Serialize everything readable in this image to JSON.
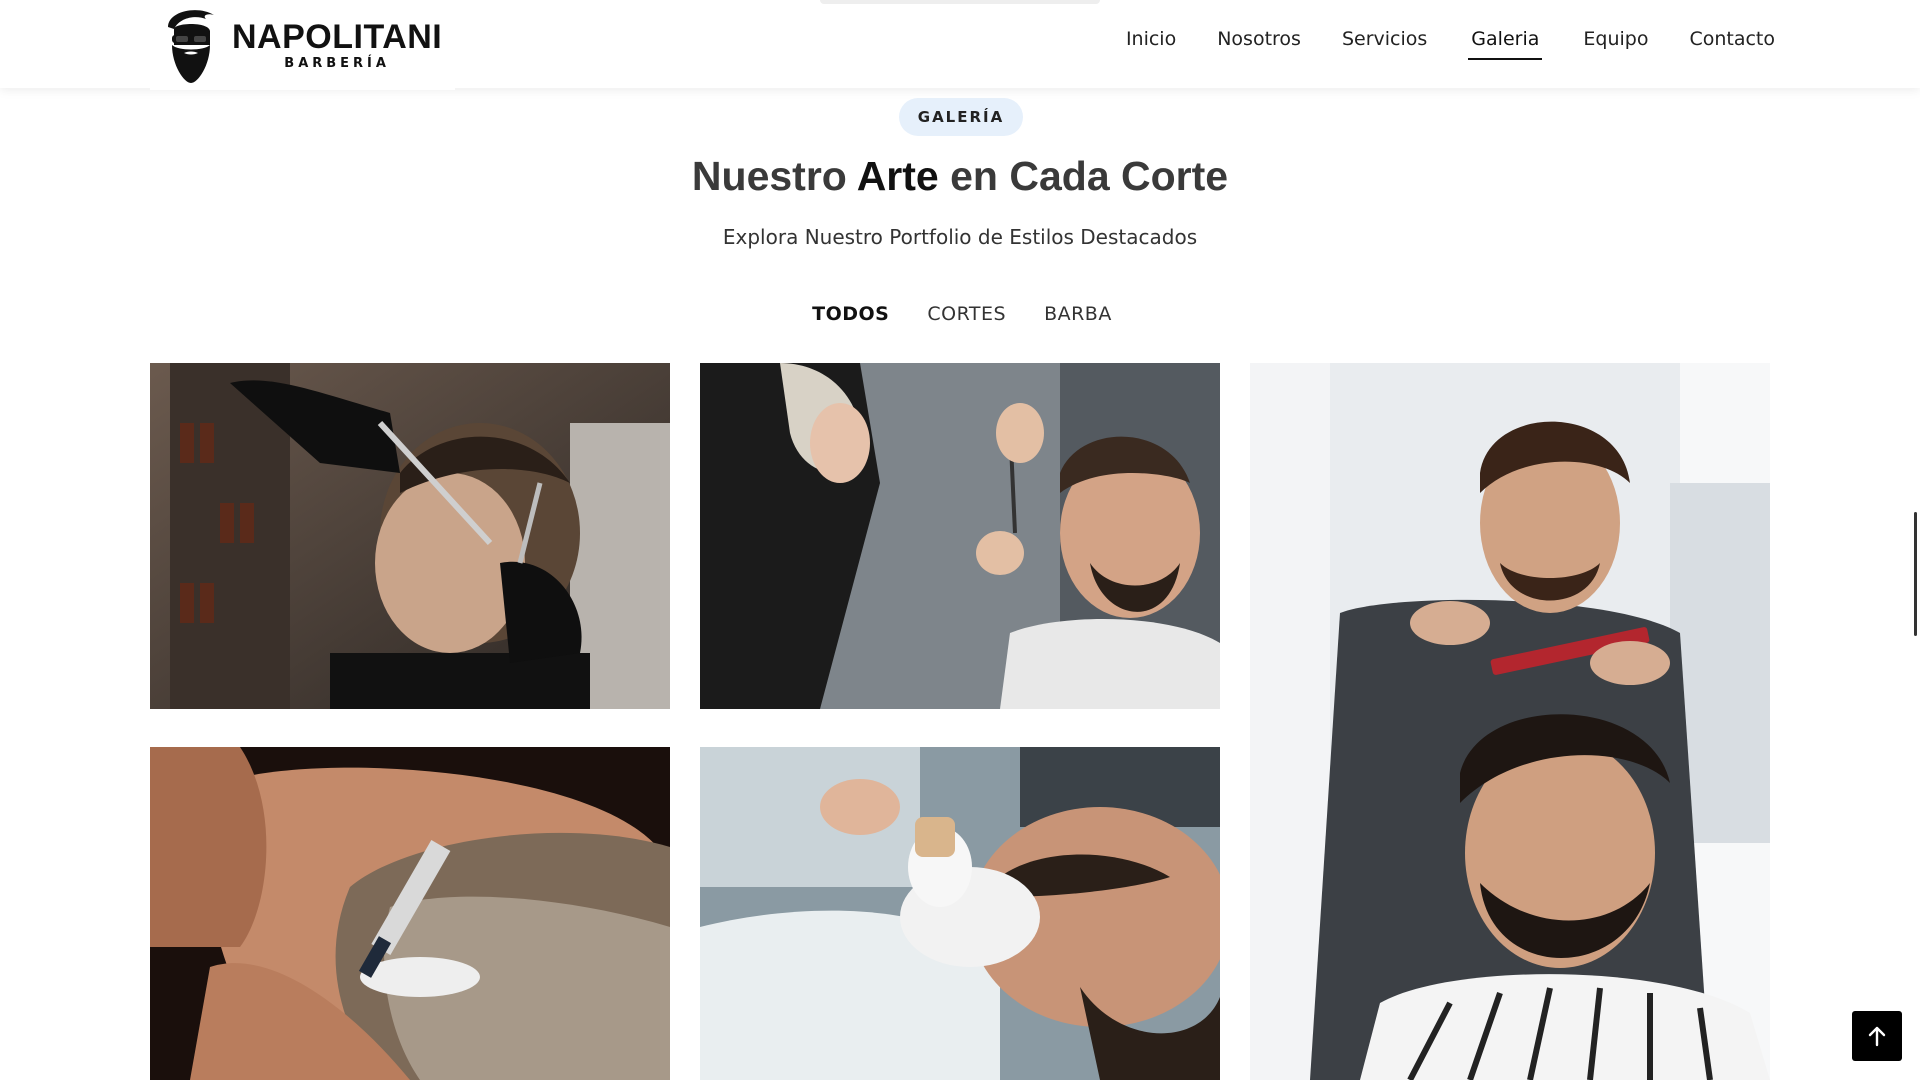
{
  "brand": {
    "name": "NAPOLITANI",
    "sub": "BARBERÍA"
  },
  "nav": [
    {
      "label": "Inicio",
      "active": false
    },
    {
      "label": "Nosotros",
      "active": false
    },
    {
      "label": "Servicios",
      "active": false
    },
    {
      "label": "Galeria",
      "active": true
    },
    {
      "label": "Equipo",
      "active": false
    },
    {
      "label": "Contacto",
      "active": false
    }
  ],
  "section": {
    "badge": "GALERÍA",
    "title_a": "Nuestro ",
    "title_em": "Arte",
    "title_b": " en Cada Corte",
    "subtitle": "Explora Nuestro Portfolio de Estilos Destacados"
  },
  "filters": [
    {
      "label": "TODOS",
      "active": true
    },
    {
      "label": "CORTES",
      "active": false
    },
    {
      "label": "BARBA",
      "active": false
    }
  ],
  "gallery": [
    {
      "name": "gallery-photo-fade-haircut"
    },
    {
      "name": "gallery-photo-scissor-cut"
    },
    {
      "name": "gallery-photo-comb-cut"
    },
    {
      "name": "gallery-photo-beard-razor"
    },
    {
      "name": "gallery-photo-shaving-brush"
    }
  ],
  "icons": {
    "scroll_top": "arrow-up-icon",
    "logo": "bearded-man-logo-icon"
  },
  "colors": {
    "badge_bg": "#e6f0fb",
    "accent": "#111111",
    "scroll_btn": "#000000"
  }
}
